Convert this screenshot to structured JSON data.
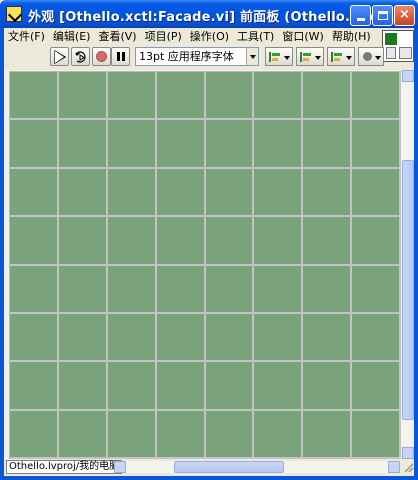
{
  "window": {
    "title": "外观 [Othello.xctl:Facade.vi] 前面板 (Othello.lvproj/...",
    "minimize_label": "minimize",
    "maximize_label": "maximize",
    "close_label": "×"
  },
  "menubar": {
    "items": [
      {
        "label": "文件(F)"
      },
      {
        "label": "编辑(E)"
      },
      {
        "label": "查看(V)"
      },
      {
        "label": "项目(P)"
      },
      {
        "label": "操作(O)"
      },
      {
        "label": "工具(T)"
      },
      {
        "label": "窗口(W)"
      },
      {
        "label": "帮助(H)"
      }
    ]
  },
  "toolbar": {
    "font_select": "13pt 应用程序字体",
    "icons": {
      "run": "run-arrow-icon",
      "run_continuously": "run-continuously-icon",
      "abort": "abort-execution-icon",
      "pause": "pause-icon",
      "align": "align-objects-icon",
      "distribute": "distribute-objects-icon",
      "resize": "resize-objects-icon",
      "reorder": "reorder-objects-icon"
    }
  },
  "board": {
    "rows": 8,
    "cols": 8,
    "cell_color": "#7ba37b",
    "grid_color": "#c4c4c4"
  },
  "statusbar": {
    "context": "Othello.lvproj/我的电脑"
  },
  "colors": {
    "titlebar": "#0054e3",
    "chrome": "#ece9d8",
    "board": "#7ba37b"
  }
}
